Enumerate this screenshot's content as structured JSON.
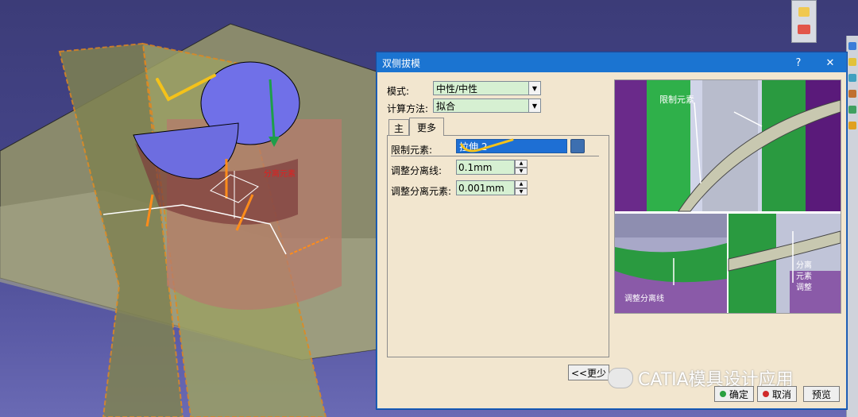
{
  "scene": {
    "annotation_red": "分离元素"
  },
  "dialog": {
    "title": "双侧拔模",
    "help": "?",
    "close": "✕",
    "mode_label": "模式:",
    "mode_value": "中性/中性",
    "method_label": "计算方法:",
    "method_value": "拟合",
    "tabs": [
      "主",
      "更多"
    ],
    "limit_label": "限制元素:",
    "limit_value": "拉伸.2",
    "adjust_line_label": "调整分离线:",
    "adjust_line_value": "0.1mm",
    "adjust_elem_label": "调整分离元素:",
    "adjust_elem_value": "0.001mm",
    "less_button": "<<更少",
    "ok_button": "确定",
    "cancel_button": "取消",
    "preview_button": "预览",
    "preview_images": {
      "limit_element": "限制元素",
      "adjust_line": "调整分离线",
      "sep_label_1": "分离",
      "sep_label_2": "元素",
      "sep_label_3": "调整"
    }
  },
  "watermark": "CATIA模具设计应用",
  "colors": {
    "titlebar": "#1b74d1",
    "dialog_bg": "#f2e6cf",
    "field_green": "#d6f0d2",
    "selection": "#1e6fd4"
  }
}
